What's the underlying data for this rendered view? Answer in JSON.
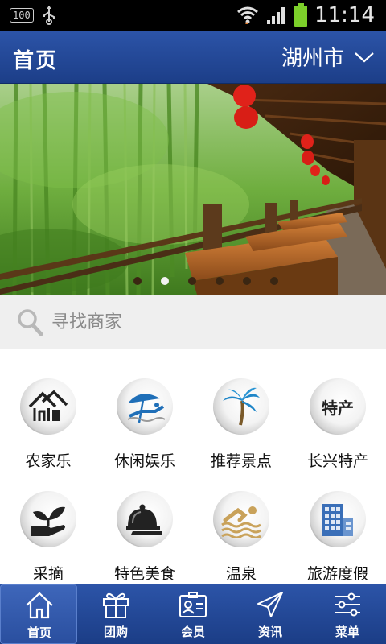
{
  "status_bar": {
    "battery_badge": "100",
    "time": "11:14"
  },
  "header": {
    "title": "首页",
    "city": "湖州市"
  },
  "banner": {
    "slide_count": 6,
    "active_slide": 2
  },
  "search": {
    "placeholder": "寻找商家"
  },
  "categories": [
    {
      "label": "农家乐",
      "icon": "farmhouse-icon"
    },
    {
      "label": "休闲娱乐",
      "icon": "umbrella-leisure-icon"
    },
    {
      "label": "推荐景点",
      "icon": "palm-tree-icon"
    },
    {
      "label": "长兴特产",
      "icon": "specialty-text-icon",
      "icon_text": "特产"
    },
    {
      "label": "采摘",
      "icon": "seedling-hand-icon"
    },
    {
      "label": "特色美食",
      "icon": "food-cloche-icon"
    },
    {
      "label": "温泉",
      "icon": "swimmer-icon"
    },
    {
      "label": "旅游度假",
      "icon": "hotel-building-icon"
    }
  ],
  "bottom_nav": [
    {
      "label": "首页",
      "icon": "home-icon",
      "active": true
    },
    {
      "label": "团购",
      "icon": "gift-icon",
      "active": false
    },
    {
      "label": "会员",
      "icon": "member-card-icon",
      "active": false
    },
    {
      "label": "资讯",
      "icon": "paper-plane-icon",
      "active": false
    },
    {
      "label": "菜单",
      "icon": "sliders-icon",
      "active": false
    }
  ],
  "colors": {
    "header_blue": "#2a50a3",
    "nav_blue": "#1f428c",
    "search_bg": "#efefef"
  }
}
